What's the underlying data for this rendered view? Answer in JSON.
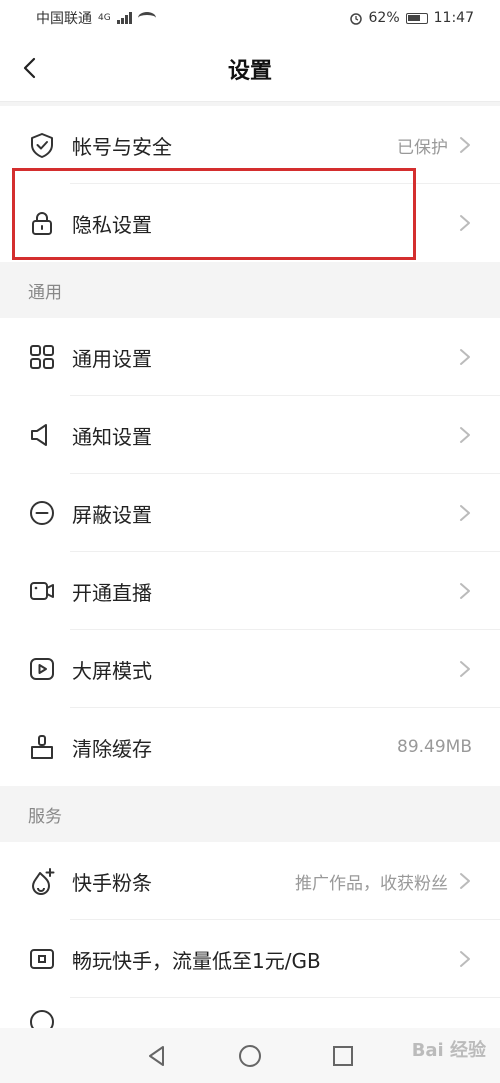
{
  "status_bar": {
    "carrier": "中国联通",
    "network": "4G",
    "battery": "62%",
    "time": "11:47"
  },
  "header": {
    "title": "设置"
  },
  "account_section": {
    "items": [
      {
        "label": "帐号与安全",
        "value": "已保护",
        "icon": "shield-check-icon"
      },
      {
        "label": "隐私设置",
        "value": "",
        "icon": "lock-icon"
      }
    ]
  },
  "general_section": {
    "title": "通用",
    "items": [
      {
        "label": "通用设置",
        "value": "",
        "icon": "grid-icon"
      },
      {
        "label": "通知设置",
        "value": "",
        "icon": "speaker-icon"
      },
      {
        "label": "屏蔽设置",
        "value": "",
        "icon": "block-icon"
      },
      {
        "label": "开通直播",
        "value": "",
        "icon": "camera-icon"
      },
      {
        "label": "大屏模式",
        "value": "",
        "icon": "play-screen-icon"
      },
      {
        "label": "清除缓存",
        "value": "89.49MB",
        "icon": "broom-icon"
      }
    ]
  },
  "services_section": {
    "title": "服务",
    "items": [
      {
        "label": "快手粉条",
        "value": "推广作品，收获粉丝",
        "icon": "fire-plus-icon"
      },
      {
        "label": "畅玩快手，流量低至1元/GB",
        "value": "",
        "icon": "sim-card-icon"
      }
    ]
  },
  "watermark": "Bai 经验",
  "colors": {
    "highlight_border": "#d42e2e",
    "background": "#f4f4f4",
    "muted_text": "#999999"
  }
}
